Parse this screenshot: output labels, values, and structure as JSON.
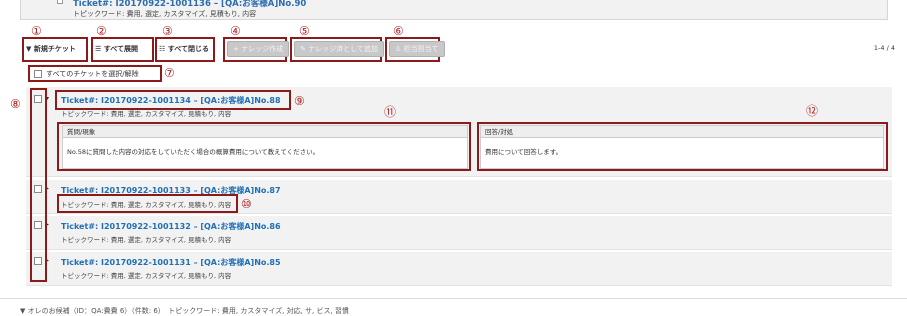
{
  "prev_ticket": {
    "title": "Ticket#: I20170922-1001136 – [QA:お客様A]No.90",
    "keywords": "トピックワード: 費用, 選定, カスタマイズ, 見積もり, 内容"
  },
  "markers": {
    "m1": "①",
    "m2": "②",
    "m3": "③",
    "m4": "④",
    "m5": "⑤",
    "m6": "⑥",
    "m7": "⑦",
    "m8": "⑧",
    "m9": "⑨",
    "m10": "⑩",
    "m11": "⑪",
    "m12": "⑫"
  },
  "toolbar": {
    "new_ticket": "新規チケット",
    "expand_all": "すべて展開",
    "collapse_all": "すべて閉じる",
    "create_knowledge": "ナレッジ作成",
    "add_as_knowledge": "ナレッジ済として追加",
    "assign_owner": "担当割当て",
    "count": "1-4 / 4"
  },
  "select_all": "すべてのチケットを選択/解除",
  "tickets": [
    {
      "title": "Ticket#: I20170922-1001134 – [QA:お客様A]No.88",
      "keywords": "トピックワード: 費用, 選定, カスタマイズ, 見積もり, 内容",
      "question_header": "質問/現象",
      "question_body": "No.58に質問した内容の対応をしていただく場合の概算費用について教えてください。",
      "answer_header": "回答/対処",
      "answer_body": "費用について回答します。"
    },
    {
      "title": "Ticket#: I20170922-1001133 – [QA:お客様A]No.87",
      "keywords": "トピックワード: 費用, 選定, カスタマイズ, 見積もり, 内容"
    },
    {
      "title": "Ticket#: I20170922-1001132 – [QA:お客様A]No.86",
      "keywords": "トピックワード: 費用, 選定, カスタマイズ, 見積もり, 内容"
    },
    {
      "title": "Ticket#: I20170922-1001131 – [QA:お客様A]No.85",
      "keywords": "トピックワード: 費用, 選定, カスタマイズ, 見積もり, 内容"
    }
  ],
  "footer": {
    "text": "▼ オレのお候補（ID：QA:費費 6）（件数: 6）　トピックワード: 費用, カスタマイズ, 対応, サ, ビス, 習慣"
  }
}
